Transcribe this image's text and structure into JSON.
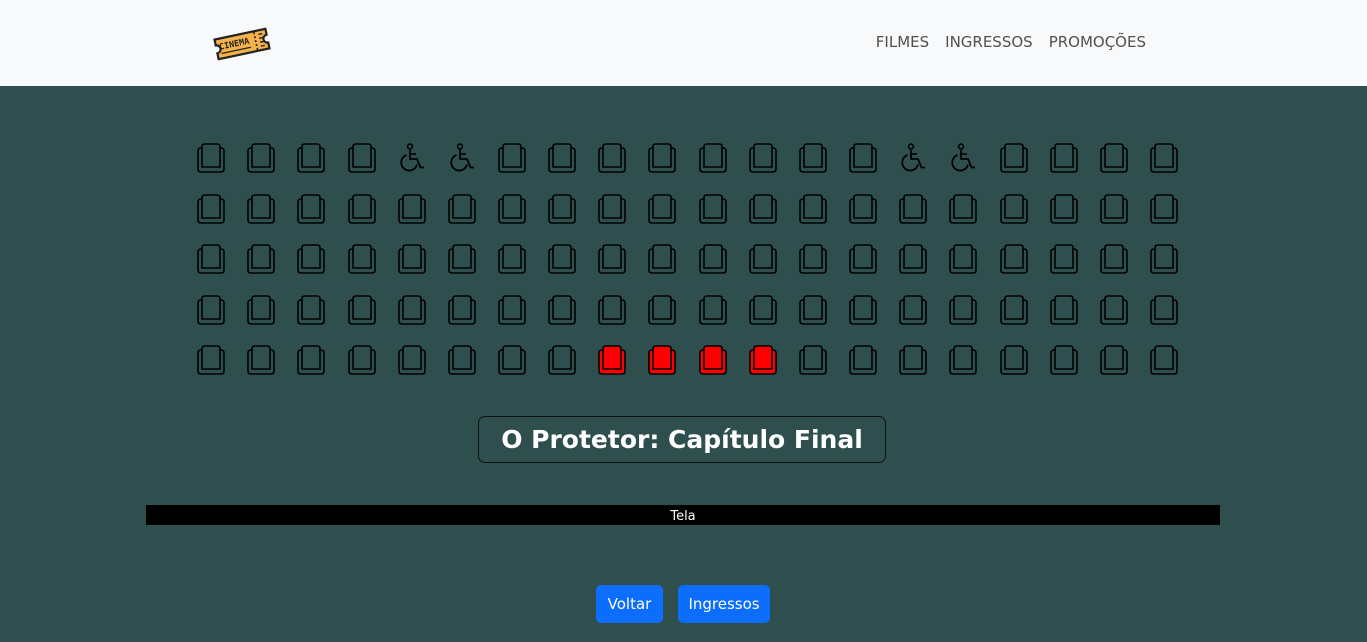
{
  "nav": {
    "logo_text": "CINEMA",
    "links": [
      "FILMES",
      "INGRESSOS",
      "PROMOÇÕES"
    ]
  },
  "seats": {
    "rows": 5,
    "cols": 20,
    "accessible": [
      [
        0,
        4
      ],
      [
        0,
        5
      ],
      [
        0,
        14
      ],
      [
        0,
        15
      ]
    ],
    "selected": [
      [
        4,
        8
      ],
      [
        4,
        9
      ],
      [
        4,
        10
      ],
      [
        4,
        11
      ]
    ],
    "colors": {
      "outline": "#000000",
      "selected_fill": "#ff0000"
    }
  },
  "movie": {
    "title": "O Protetor: Capítulo Final"
  },
  "screen": {
    "label": "Tela"
  },
  "buttons": {
    "back": "Voltar",
    "tickets": "Ingressos"
  },
  "colors": {
    "background": "#2f4f4f",
    "navbar": "#f8f9fa",
    "primary": "#0d6efd"
  }
}
